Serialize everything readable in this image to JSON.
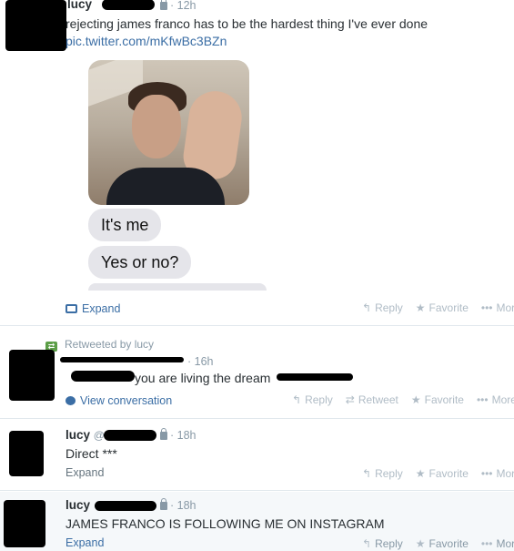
{
  "tweets": [
    {
      "name": "lucy",
      "time": "12h",
      "text": "rejecting james franco has to be the hardest thing I've ever done",
      "link": "pic.twitter.com/mKfwBc3BZn",
      "bubbles": [
        "It's me",
        "Yes or no?"
      ],
      "expand": "Expand",
      "actions": [
        "Reply",
        "Favorite",
        "More"
      ]
    },
    {
      "retweeted_by": "Retweeted by lucy",
      "time": "16h",
      "text": "you are living the dream",
      "conversation": "View conversation",
      "actions": [
        "Reply",
        "Retweet",
        "Favorite",
        "More"
      ]
    },
    {
      "name": "lucy",
      "at": "@",
      "time": "18h",
      "text": "Direct ***",
      "expand": "Expand",
      "actions": [
        "Reply",
        "Favorite",
        "More"
      ]
    },
    {
      "name": "lucy",
      "time": "18h",
      "text": "JAMES FRANCO IS FOLLOWING ME ON INSTAGRAM",
      "expand": "Expand",
      "actions": [
        "Reply",
        "Favorite",
        "More"
      ]
    }
  ],
  "colors": {
    "link": "#3b6ea5",
    "muted": "#8899a6",
    "retweet": "#5c9e47"
  },
  "icons": [
    "lock-icon",
    "reply-icon",
    "retweet-icon",
    "favorite-star-icon",
    "more-dots-icon",
    "expand-photo-icon",
    "conversation-bubble-icon"
  ]
}
